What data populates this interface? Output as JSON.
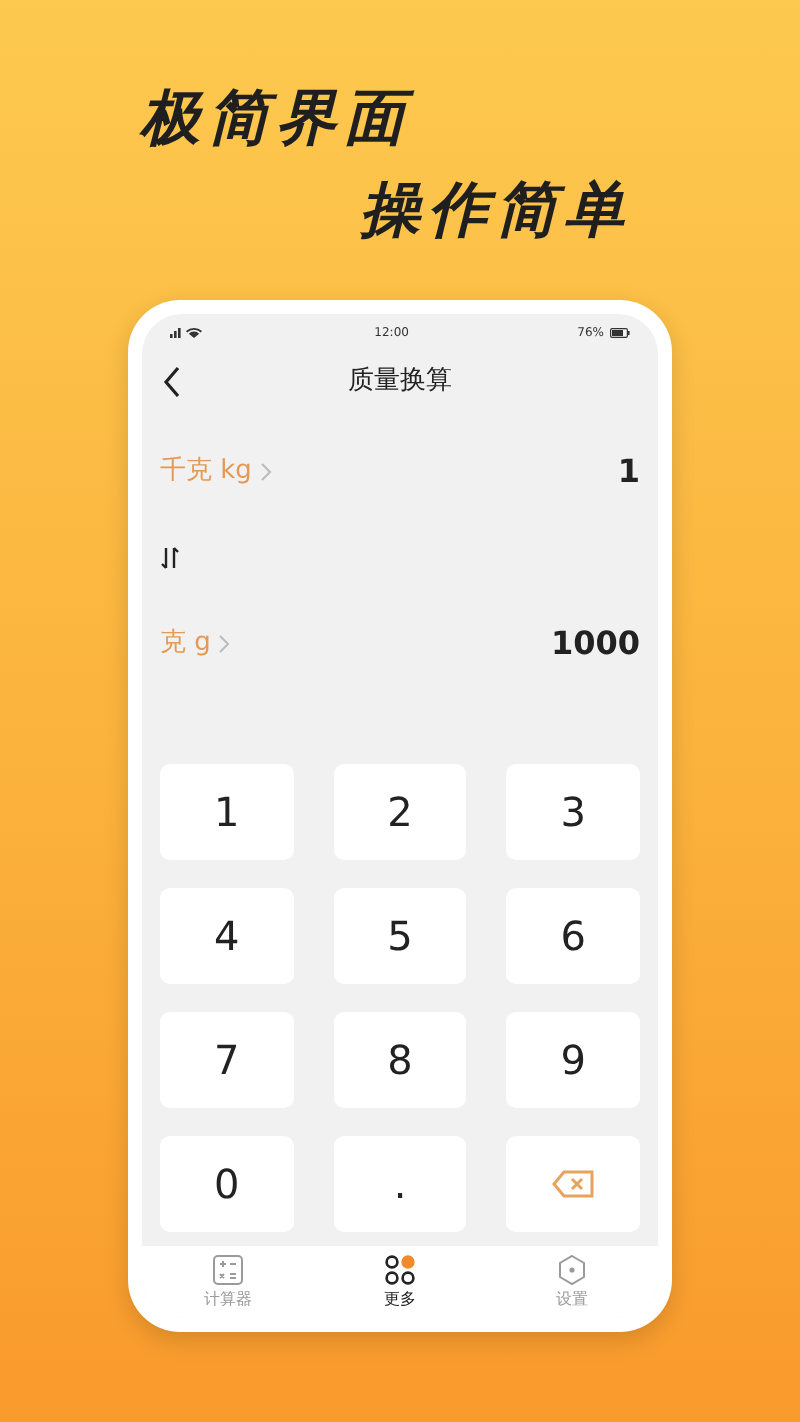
{
  "headline": [
    "极简界面",
    "操作简单"
  ],
  "status_bar": {
    "time": "12:00",
    "battery": "76%"
  },
  "header": {
    "title": "质量换算"
  },
  "units": [
    {
      "unit": "千克 kg",
      "value": "1"
    },
    {
      "unit": "克 g",
      "value": "1000"
    }
  ],
  "keypad": [
    {
      "kind": "digit",
      "label": "1"
    },
    {
      "kind": "digit",
      "label": "2"
    },
    {
      "kind": "digit",
      "label": "3"
    },
    {
      "kind": "digit",
      "label": "4"
    },
    {
      "kind": "digit",
      "label": "5"
    },
    {
      "kind": "digit",
      "label": "6"
    },
    {
      "kind": "digit",
      "label": "7"
    },
    {
      "kind": "digit",
      "label": "8"
    },
    {
      "kind": "digit",
      "label": "9"
    },
    {
      "kind": "digit",
      "label": "0"
    },
    {
      "kind": "digit",
      "label": "."
    },
    {
      "kind": "backspace"
    }
  ],
  "tab_bar": [
    {
      "kind": "calculator",
      "label": "计算器",
      "selected": false
    },
    {
      "kind": "more",
      "label": "更多",
      "selected": true
    },
    {
      "kind": "settings",
      "label": "设置",
      "selected": false
    }
  ]
}
